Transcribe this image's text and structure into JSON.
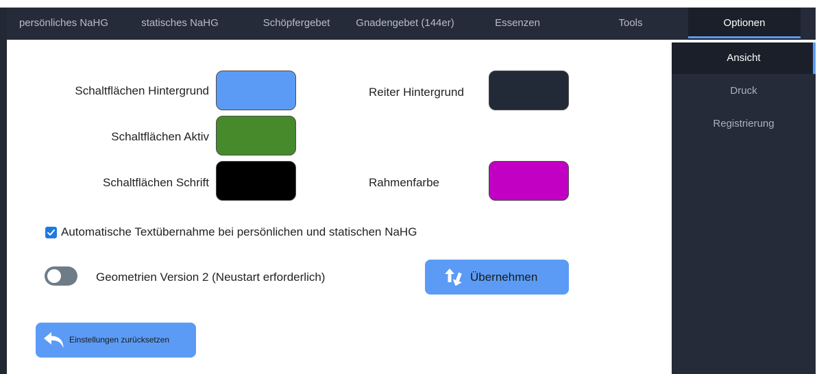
{
  "tabs": [
    {
      "label": "persönliches NaHG",
      "active": false
    },
    {
      "label": "statisches NaHG",
      "active": false
    },
    {
      "label": "Schöpfergebet",
      "active": false
    },
    {
      "label": "Gnadengebet (144er)",
      "active": false
    },
    {
      "label": "Essenzen",
      "active": false
    },
    {
      "label": "Tools",
      "active": false
    },
    {
      "label": "Optionen",
      "active": true
    }
  ],
  "sidebar": {
    "items": [
      {
        "label": "Ansicht",
        "active": true
      },
      {
        "label": "Druck",
        "active": false
      },
      {
        "label": "Registrierung",
        "active": false
      }
    ]
  },
  "colors": {
    "button_background": {
      "label": "Schaltflächen Hintergrund",
      "value": "#5b9bf5"
    },
    "button_active": {
      "label": "Schaltflächen Aktiv",
      "value": "#468a2c"
    },
    "button_text": {
      "label": "Schaltflächen Schrift",
      "value": "#000000"
    },
    "tab_background": {
      "label": "Reiter Hintergrund",
      "value": "#232a37"
    },
    "border_color": {
      "label": "Rahmenfarbe",
      "value": "#c100c4"
    }
  },
  "auto_text": {
    "label": "Automatische Textübernahme bei persönlichen und statischen NaHG",
    "checked": true
  },
  "geometry_v2": {
    "label": "Geometrien Version 2 (Neustart erforderlich)",
    "enabled": false
  },
  "apply_button": {
    "label": "Übernehmen",
    "icon": "swap-arrows-icon"
  },
  "reset_button": {
    "label": "Einstellungen zurücksetzen",
    "icon": "undo-arrow-icon"
  },
  "theme": {
    "accent": "#5b9bf5",
    "tabbar_bg": "#252b38",
    "active_tab_bg": "#1b1f29",
    "checkbox": "#1f7ae0",
    "toggle_off": "#6f7c87"
  }
}
